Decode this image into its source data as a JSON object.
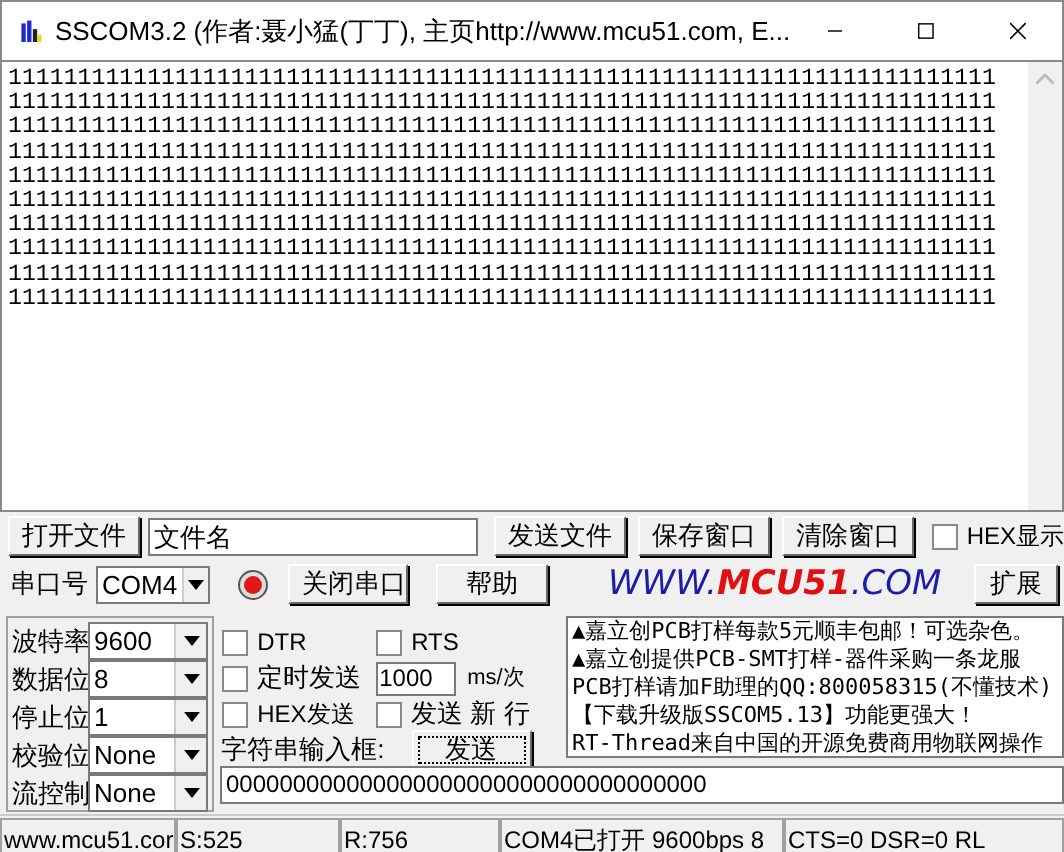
{
  "window": {
    "title": "SSCOM3.2 (作者:聂小猛(丁丁), 主页http://www.mcu51.com,  E..."
  },
  "output": {
    "lines": [
      "11111111111111111111111111111111111111111111111111111111111111111111111",
      "11111111111111111111111111111111111111111111111111111111111111111111111",
      "11111111111111111111111111111111111111111111111111111111111111111111111",
      "11111111111111111111111111111111111111111111111111111111111111111111111",
      "11111111111111111111111111111111111111111111111111111111111111111111111",
      "11111111111111111111111111111111111111111111111111111111111111111111111",
      "11111111111111111111111111111111111111111111111111111111111111111111111",
      "11111111111111111111111111111111111111111111111111111111111111111111111",
      "11111111111111111111111111111111111111111111111111111111111111111111111",
      "11111111111111111111111111111111111111111111111111111111111111111111111"
    ]
  },
  "file_row": {
    "open_button": "打开文件",
    "file_field": "文件名",
    "buttons": [
      "发送文件",
      "保存窗口",
      "清除窗口"
    ],
    "hex_display": {
      "label": "HEX显示",
      "checked": false
    }
  },
  "port_row": {
    "label": "串口号",
    "port": "COM4",
    "port_open": true,
    "buttons": [
      "关闭串口",
      "帮助"
    ],
    "logo": [
      "WWW.",
      "MCU51",
      ".COM"
    ],
    "expand_button": "扩展"
  },
  "settings": [
    {
      "label": "波特率",
      "value": "9600"
    },
    {
      "label": "数据位",
      "value": "8"
    },
    {
      "label": "停止位",
      "value": "1"
    },
    {
      "label": "校验位",
      "value": "None"
    },
    {
      "label": "流控制",
      "value": "None"
    }
  ],
  "options": {
    "dtr": {
      "label": "DTR",
      "checked": false
    },
    "rts": {
      "label": "RTS",
      "checked": false
    },
    "timed_send": {
      "label": "定时发送",
      "checked": false
    },
    "interval": "1000",
    "interval_unit": "ms/次",
    "hex_send": {
      "label": "HEX发送",
      "checked": false
    },
    "send_newline": {
      "label": "发送 新 行",
      "checked": false
    },
    "input_label": "字符串输入框:",
    "send_button": "发送"
  },
  "notices": [
    "▲嘉立创PCB打样每款5元顺丰包邮！可选杂色。",
    "▲嘉立创提供PCB-SMT打样-器件采购一条龙服",
    "PCB打样请加F助理的QQ:800058315(不懂技术)",
    "【下载升级版SSCOM5.13】功能更强大！",
    "RT-Thread来自中国的开源免费商用物联网操作"
  ],
  "send_field": "000000000000000000000000000000000000",
  "status_bar": [
    "www.mcu51.cor",
    "S:525",
    "R:756",
    "COM4已打开  9600bps  8",
    "CTS=0 DSR=0 RL"
  ]
}
